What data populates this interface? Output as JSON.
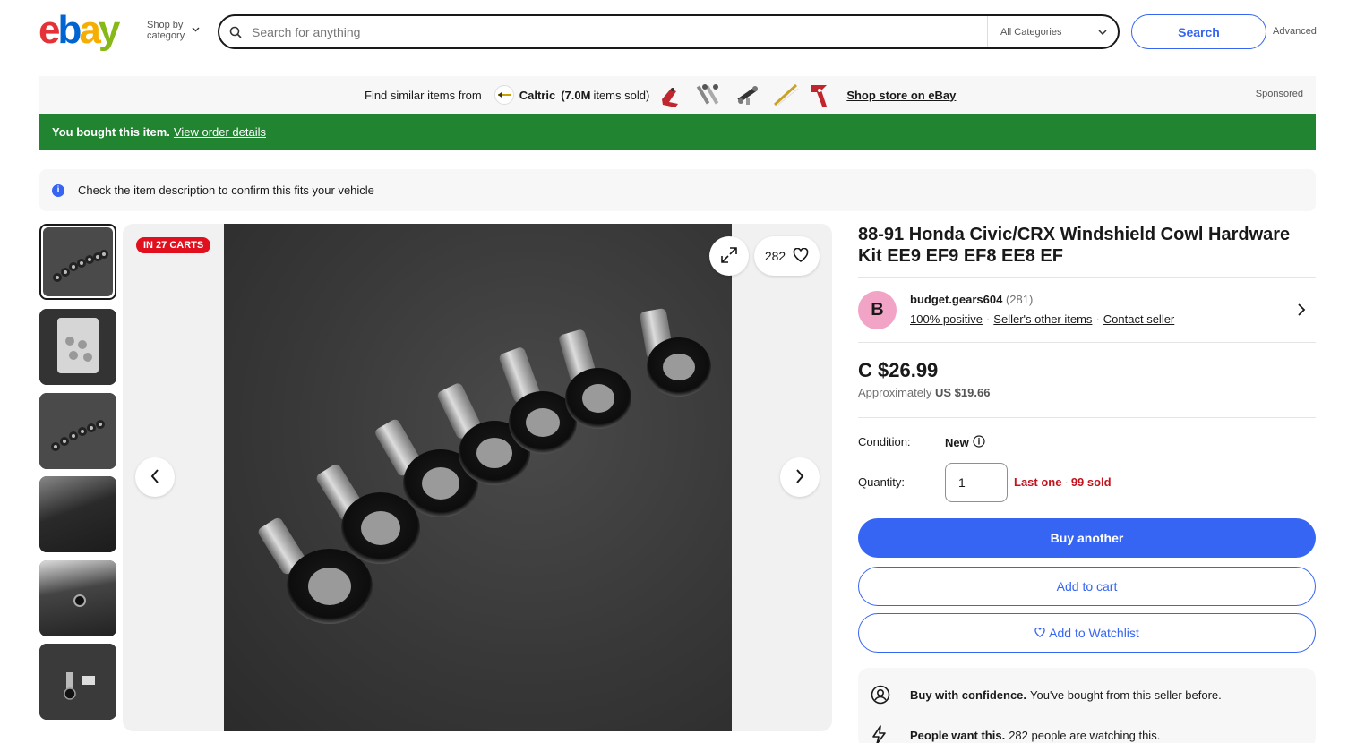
{
  "header": {
    "logo_letters": [
      "e",
      "b",
      "a",
      "y"
    ],
    "shop_by_line1": "Shop by",
    "shop_by_line2": "category",
    "search_placeholder": "Search for anything",
    "category_selected": "All Categories",
    "search_label": "Search",
    "advanced_label": "Advanced"
  },
  "sponsor": {
    "find_text": "Find similar items from",
    "store_name": "Caltric",
    "items_sold_count": "(7.0M",
    "items_sold_suffix": "items sold)",
    "shop_store": "Shop store on eBay",
    "sponsored": "Sponsored"
  },
  "bought": {
    "text": "You bought this item.",
    "link": "View order details"
  },
  "info": {
    "text": "Check the item description to confirm this fits your vehicle"
  },
  "gallery": {
    "carts_badge": "IN 27 CARTS",
    "watch_count": "282"
  },
  "item": {
    "title": "88-91 Honda Civic/CRX Windshield Cowl Hardware Kit EE9 EF9 EF8 EE8 EF",
    "seller_initial": "B",
    "seller_name": "budget.gears604",
    "seller_feedback": "(281)",
    "positive": "100% positive",
    "other_items": "Seller's other items",
    "contact": "Contact seller",
    "price": "C $26.99",
    "approx_prefix": "Approximately",
    "approx_value": "US $19.66",
    "condition_label": "Condition:",
    "condition_value": "New",
    "quantity_label": "Quantity:",
    "quantity_value": "1",
    "last_one": "Last one",
    "sold": "99 sold",
    "buy_another": "Buy another",
    "add_to_cart": "Add to cart",
    "add_to_watchlist": "Add to Watchlist"
  },
  "confidence": {
    "row1_bold": "Buy with confidence.",
    "row1_text": "You've bought from this seller before.",
    "row2_bold": "People want this.",
    "row2_text": "282 people are watching this."
  },
  "colors": {
    "accent": "#3665f3",
    "success": "#218431",
    "alert": "#e0101e"
  }
}
